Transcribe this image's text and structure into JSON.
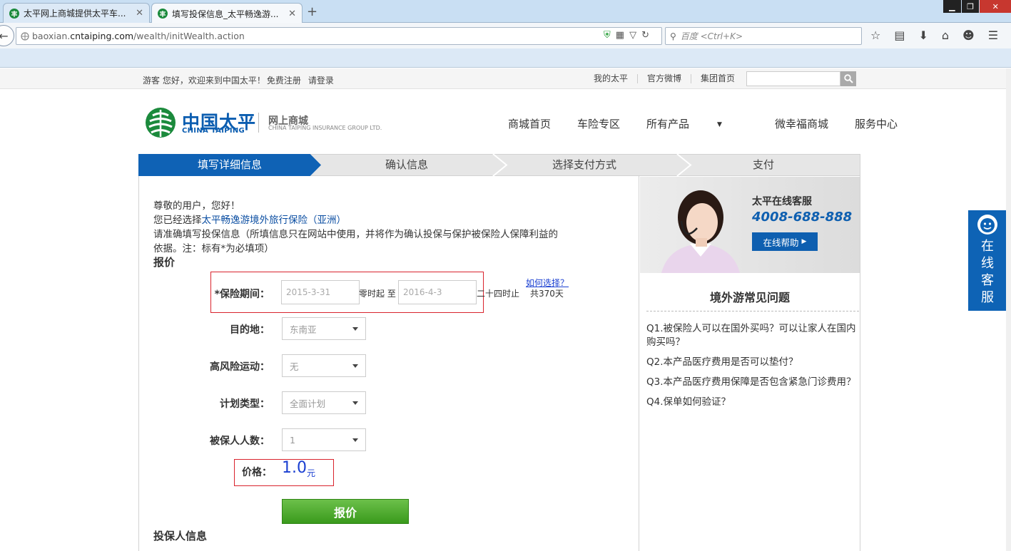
{
  "browser": {
    "tabs": [
      {
        "title": "太平网上商城提供太平车..."
      },
      {
        "title": "填写投保信息_太平畅逸游..."
      }
    ],
    "url_prefix": "baoxian.",
    "url_domain": "cntaiping.com",
    "url_path": "/wealth/initWealth.action",
    "search_placeholder": "百度 <Ctrl+K>"
  },
  "site_topbar": {
    "welcome": "游客 您好，欢迎来到中国太平！",
    "register": "免费注册",
    "login": "请登录",
    "links": [
      "我的太平",
      "官方微博",
      "集团首页"
    ]
  },
  "header": {
    "logo_cn": "中国太平",
    "logo_en": "CHINA TAIPING",
    "sub_cn": "网上商城",
    "sub_en": "CHINA TAIPING INSURANCE GROUP LTD.",
    "nav": [
      "商城首页",
      "车险专区",
      "所有产品",
      "微幸福商城",
      "服务中心"
    ]
  },
  "steps": [
    "填写详细信息",
    "确认信息",
    "选择支付方式",
    "支付"
  ],
  "intro": {
    "greeting": "尊敬的用户，您好！",
    "selected_prefix": "您已经选择",
    "product": "太平畅逸游境外旅行保险（亚洲）",
    "instructions": "请准确填写投保信息（所填信息只在网站中使用，并将作为确认投保与保护被保险人保障利益的依据。注：标有*为必填项）"
  },
  "quote": {
    "title": "报价",
    "period_label": "*保险期间：",
    "start_date": "2015-3-31",
    "from_text": "零时起 至",
    "end_date": "2016-4-3",
    "end_text": "二十四时止",
    "how_link": "如何选择？",
    "total_days": "共370天",
    "destination_label": "目的地：",
    "destination_value": "东南亚",
    "risk_sport_label": "高风险运动：",
    "risk_sport_value": "无",
    "plan_label": "计划类型：",
    "plan_value": "全面计划",
    "insured_count_label": "被保人人数：",
    "insured_count_value": "1",
    "price_label": "价格：",
    "price_value": "1.0",
    "price_unit": "元",
    "quote_button": "报价"
  },
  "holder_title": "投保人信息",
  "customer_service": {
    "title": "太平在线客服",
    "phone": "4008-688-888",
    "help_button": "在线帮助"
  },
  "faq": {
    "title": "境外游常见问题",
    "items": [
      "Q1.被保险人可以在国外买吗？可以让家人在国内购买吗？",
      "Q2.本产品医疗费用是否可以垫付？",
      "Q3.本产品医疗费用保障是否包含紧急门诊费用？",
      "Q4.保单如何验证？"
    ]
  },
  "float_service": [
    "在",
    "线",
    "客",
    "服"
  ],
  "colors": {
    "brand_blue": "#0f62b5",
    "price_blue": "#1a3fd1",
    "highlight_red": "#d9232d",
    "button_green": "#4aa82a"
  }
}
